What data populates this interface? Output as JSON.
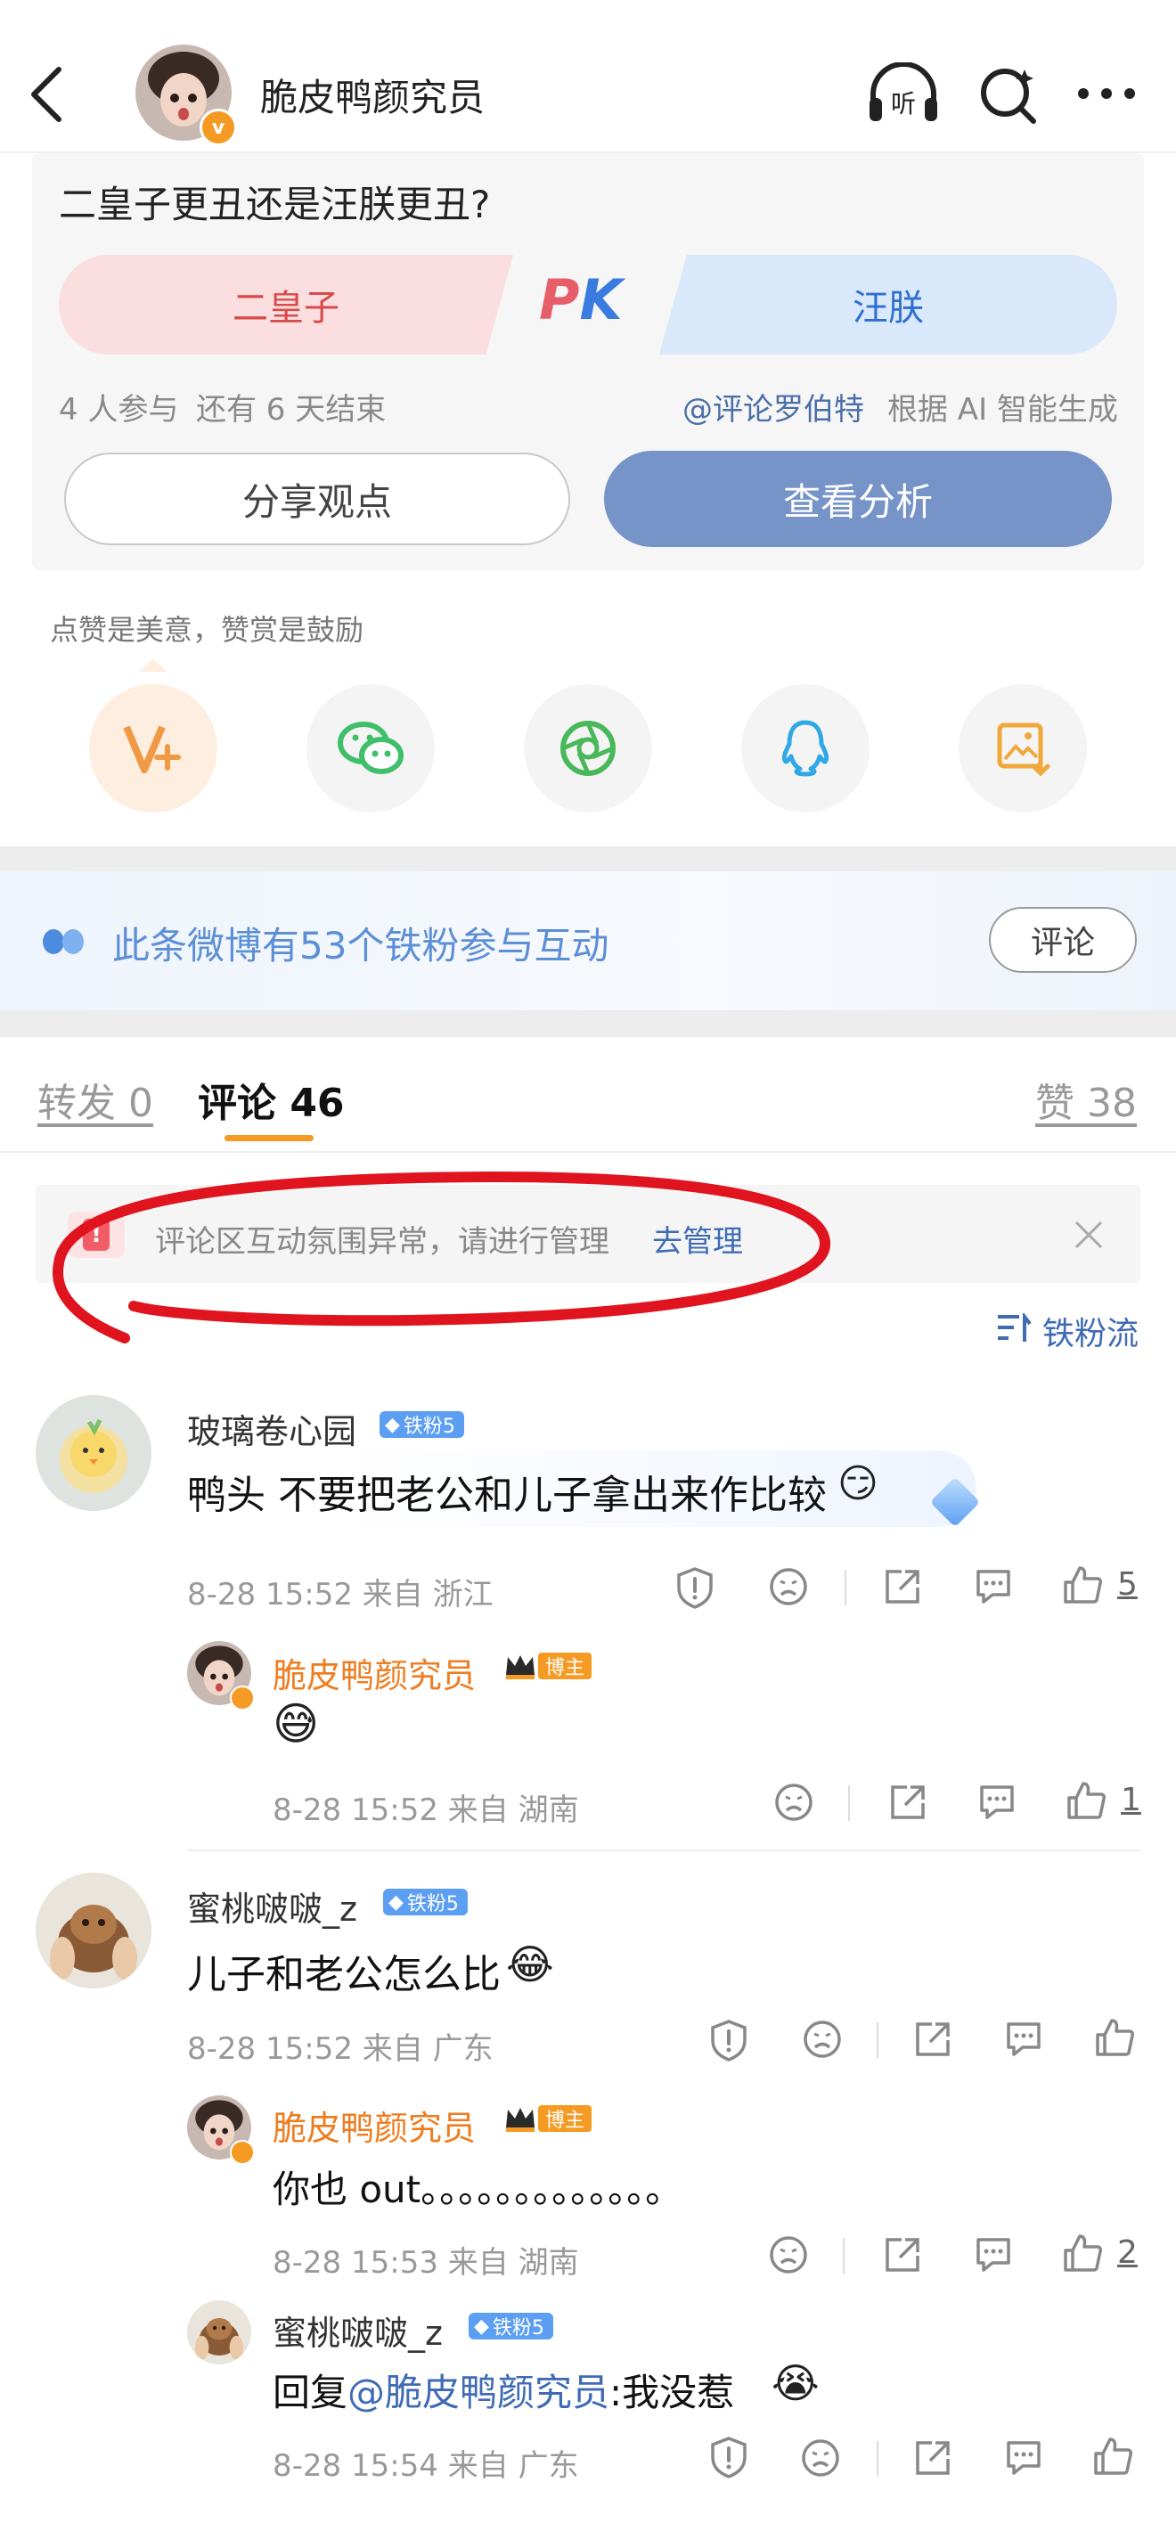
{
  "header": {
    "back_icon": "chevron-left-icon",
    "username": "脆皮鸭颜究员",
    "listen_icon": "headphones-listen-icon",
    "search_icon": "search-icon",
    "more_icon": "more-dots-icon"
  },
  "pk": {
    "question": "二皇子更丑还是汪朕更丑?",
    "option_left": "二皇子",
    "option_right": "汪朕",
    "vs_label": "PK",
    "participants": "4 人参与",
    "time_left": "还有 6 天结束",
    "source_mention": "@评论罗伯特",
    "source_note": "根据 AI 智能生成",
    "share_button": "分享观点",
    "view_button": "查看分析"
  },
  "appreciation": {
    "hint": "点赞是美意，赞赏是鼓励",
    "share_targets": [
      {
        "name": "reward-vplus-icon",
        "color": "#f09a45"
      },
      {
        "name": "wechat-icon",
        "color": "#3fbf6a"
      },
      {
        "name": "moments-icon",
        "color": "#49b85b"
      },
      {
        "name": "qq-icon",
        "color": "#2fa8e6"
      },
      {
        "name": "save-image-icon",
        "color": "#f0a83a"
      }
    ]
  },
  "fan_banner": {
    "text": "此条微博有53个铁粉参与互动",
    "button": "评论"
  },
  "tabs": {
    "repost": "转发 0",
    "comments": "评论 46",
    "likes": "赞 38"
  },
  "notice": {
    "text": "评论区互动氛围异常，请进行管理",
    "link": "去管理"
  },
  "sort_label": "铁粉流",
  "comments": [
    {
      "user": "玻璃卷心园",
      "badge": "铁粉5",
      "text": "鸭头 不要把老公和儿子拿出来作比较",
      "meta": "8-28 15:52 来自 浙江",
      "likes": "5",
      "reply": {
        "user": "脆皮鸭颜究员",
        "badge": "博主",
        "text": "",
        "meta": "8-28 15:52 来自 湖南",
        "likes": "1"
      }
    },
    {
      "user": "蜜桃啵啵_z",
      "badge": "铁粉5",
      "text": "儿子和老公怎么比",
      "meta": "8-28 15:52 来自 广东",
      "likes": "",
      "replies": [
        {
          "user": "脆皮鸭颜究员",
          "badge": "博主",
          "text": "你也 out。。。。。。。。。。。。。",
          "meta": "8-28 15:53 来自 湖南",
          "likes": "2"
        },
        {
          "user": "蜜桃啵啵_z",
          "badge": "铁粉5",
          "text_prefix": "回复",
          "mention": "@脆皮鸭颜究员",
          "text": ":我没惹",
          "meta": "8-28 15:54 来自 广东",
          "likes": ""
        }
      ]
    }
  ],
  "colors": {
    "accent_orange": "#f59a23",
    "link_blue": "#3f6bb5",
    "annotation_red": "#e0141e"
  }
}
